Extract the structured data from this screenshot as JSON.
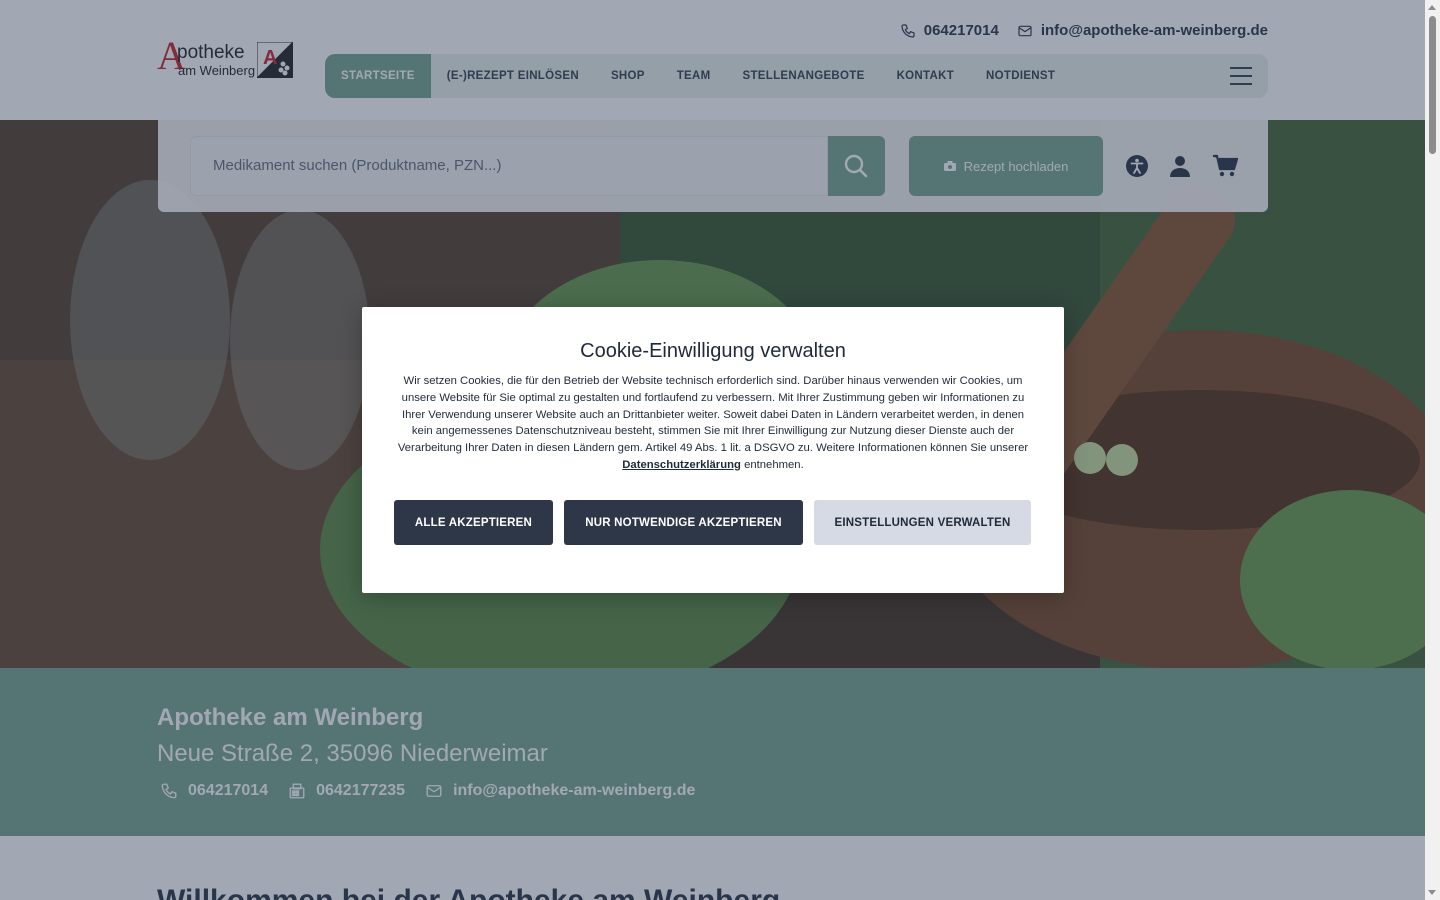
{
  "header": {
    "logo": {
      "initial": "A",
      "word": "potheke",
      "sub": "am Weinberg"
    },
    "phone": "064217014",
    "email": "info@apotheke-am-weinberg.de"
  },
  "nav": {
    "items": [
      "STARTSEITE",
      "(E-)REZEPT EINLÖSEN",
      "SHOP",
      "TEAM",
      "STELLENANGEBOTE",
      "KONTAKT",
      "NOTDIENST"
    ],
    "active_index": 0
  },
  "search": {
    "placeholder": "Medikament suchen (Produktname, PZN...)",
    "upload_label": "Rezept hochladen"
  },
  "info": {
    "name": "Apotheke am Weinberg",
    "address": "Neue Straße 2, 35096 Niederweimar",
    "phone": "064217014",
    "fax": "0642177235",
    "email": "info@apotheke-am-weinberg.de"
  },
  "welcome_title": "Willkommen bei der Apotheke am Weinberg",
  "cookie": {
    "title": "Cookie-Einwilligung verwalten",
    "text_before_link": "Wir setzen Cookies, die für den Betrieb der Website technisch erforderlich sind. Darüber hinaus verwenden wir Cookies, um unsere Website für Sie optimal zu gestalten und fortlaufend zu verbessern. Mit Ihrer Zustimmung geben wir Informationen zu Ihrer Verwendung unserer Website auch an Drittanbieter weiter. Soweit dabei Daten in Ländern verarbeitet werden, in denen kein angemessenes Datenschutzniveau besteht, stimmen Sie mit Ihrer Einwilligung zur Nutzung dieser Dienste auch der Verarbeitung Ihrer Daten in diesen Ländern gem. Artikel 49 Abs. 1 lit. a DSGVO zu. Weitere Informationen können Sie unserer",
    "link_text": "Datenschutzerklärung",
    "text_after_link": "entnehmen.",
    "accept_all": "ALLE AKZEPTIEREN",
    "accept_necessary": "NUR NOTWENDIGE AKZEPTIEREN",
    "manage": "EINSTELLUNGEN VERWALTEN"
  },
  "colors": {
    "accent_green": "#7aa593",
    "dark_button": "#2d3748",
    "light_button": "#d5dae5",
    "brand_red": "#c92a33"
  }
}
